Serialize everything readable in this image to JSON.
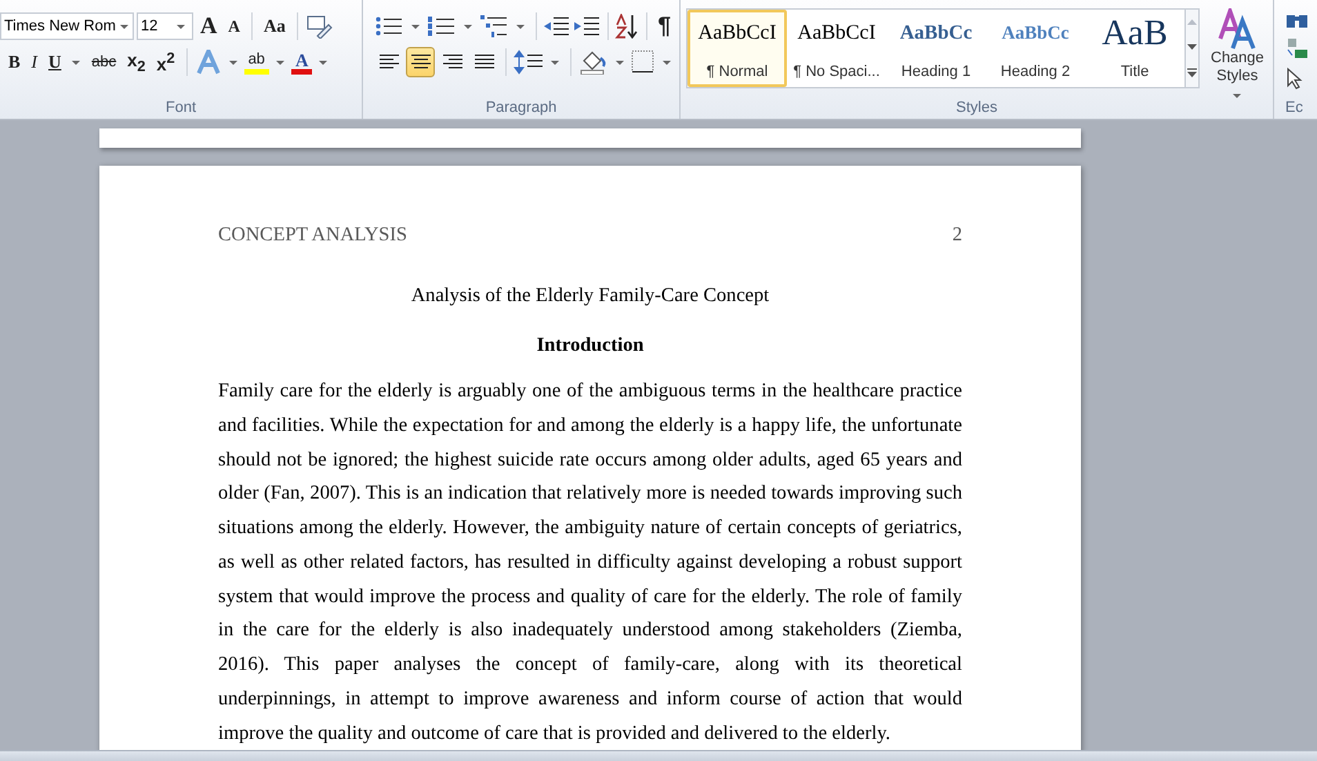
{
  "ribbon": {
    "font": {
      "label": "Font",
      "font_name": "Times New Rom",
      "font_size": "12",
      "grow": "A",
      "shrink": "A",
      "change_case": "Aa",
      "bold": "B",
      "italic": "I",
      "underline": "U",
      "strike": "abc",
      "subscript": "x$_{2}$",
      "superscript": "x$^{2}$",
      "highlight": "ab",
      "font_color": "A"
    },
    "paragraph": {
      "label": "Paragraph",
      "pilcrow": "¶",
      "alignment": [
        {
          "selected": false
        },
        {
          "selected": true
        },
        {
          "selected": false
        },
        {
          "selected": false
        }
      ]
    },
    "styles": {
      "label": "Styles",
      "items": [
        {
          "preview": "AaBbCcI",
          "name": "¶ Normal",
          "kind": "normal",
          "selected": true
        },
        {
          "preview": "AaBbCcI",
          "name": "¶ No Spaci...",
          "kind": "normal",
          "selected": false
        },
        {
          "preview": "AaBbCc",
          "name": "Heading 1",
          "kind": "heading1",
          "selected": false
        },
        {
          "preview": "AaBbCc",
          "name": "Heading 2",
          "kind": "heading2",
          "selected": false
        },
        {
          "preview": "AaB",
          "name": "Title",
          "kind": "title",
          "selected": false
        }
      ],
      "change_styles": [
        "Change",
        "Styles"
      ]
    },
    "editing": {
      "label": "Ec"
    }
  },
  "document": {
    "header": {
      "title": "CONCEPT ANALYSIS",
      "page_number": "2"
    },
    "title": "Analysis of the Elderly Family-Care Concept",
    "heading": "Introduction",
    "paragraph": "Family care for the elderly is arguably one of the ambiguous terms in the healthcare practice and facilities. While the expectation for and among the elderly is a happy life, the unfortunate should not be ignored; the highest suicide rate occurs among older adults, aged 65 years and older (Fan, 2007). This is an indication that relatively more is needed towards improving such situations among the elderly. However, the ambiguity nature of certain concepts of geriatrics, as well as other related factors, has resulted in difficulty against developing a robust support system that would improve the process and quality of care for the elderly. The role of family in the care for the elderly is also inadequately understood among stakeholders (Ziemba, 2016). This paper analyses the concept of family-care, along with its theoretical underpinnings, in attempt to improve awareness and inform course of action that would improve the quality and outcome of care that is provided and delivered to the elderly."
  }
}
